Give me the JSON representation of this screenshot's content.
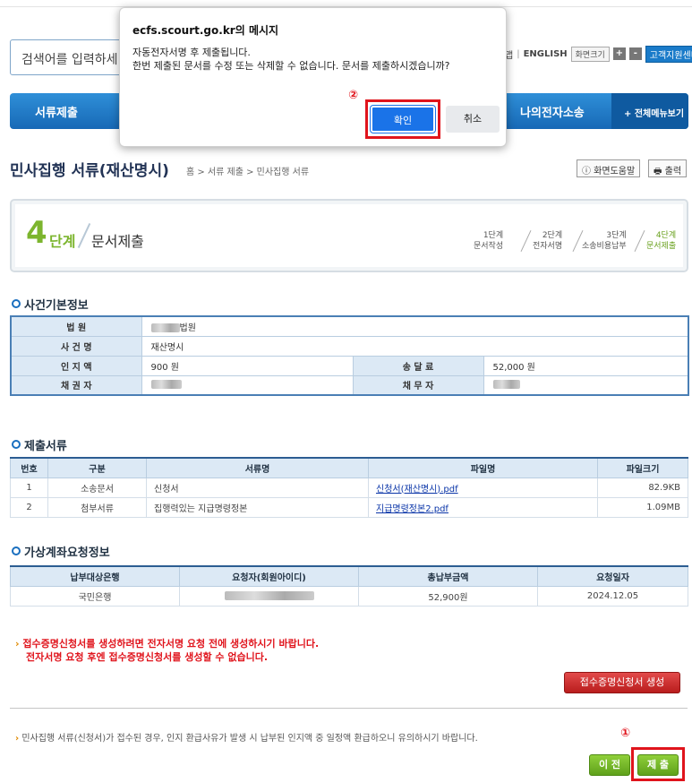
{
  "header": {
    "search_placeholder": "검색어를 입력하세",
    "links": [
      "맵",
      "ENGLISH"
    ],
    "font_btn": "화면크기",
    "zoom_in": "+",
    "zoom_out": "-",
    "cs_btn": "고객지원센터"
  },
  "nav": {
    "items": [
      "서류제출",
      "나의전자소송"
    ],
    "all_menu": "+ 전체메뉴보기"
  },
  "page": {
    "title": "민사집행 서류(재산명시)",
    "breadcrumb": "홈 > 서류 제출 > 민사집행 서류",
    "help_btn": "ⓘ 화면도움말",
    "print_btn": "출력"
  },
  "step": {
    "num": "4",
    "unit": "단계",
    "name": "문서제출",
    "steps": [
      {
        "label": "1단계",
        "sub": "문서작성"
      },
      {
        "label": "2단계",
        "sub": "전자서명"
      },
      {
        "label": "3단계",
        "sub": "소송비용납부"
      },
      {
        "label": "4단계",
        "sub": "문서제출"
      }
    ]
  },
  "case_info": {
    "title": "사건기본정보",
    "court_label": "법 원",
    "court_value": "법원",
    "case_label": "사 건 명",
    "case_value": "재산명시",
    "stamp_label": "인 지 액",
    "stamp_value": "900 원",
    "delivery_label": "송 달 료",
    "delivery_value": "52,000 원",
    "creditor_label": "채 권 자",
    "debtor_label": "채 무 자"
  },
  "files": {
    "title": "제출서류",
    "headers": [
      "번호",
      "구분",
      "서류명",
      "파일명",
      "파일크기"
    ],
    "rows": [
      {
        "no": "1",
        "type": "소송문서",
        "name": "신청서",
        "file": "신청서(재산명시).pdf",
        "size": "82.9KB"
      },
      {
        "no": "2",
        "type": "첨부서류",
        "name": "집행력있는 지급명령정본",
        "file": "지급명령정본2.pdf",
        "size": "1.09MB"
      }
    ]
  },
  "account": {
    "title": "가상계좌요청정보",
    "headers": [
      "납부대상은행",
      "요청자(회원아이디)",
      "총납부금액",
      "요청일자"
    ],
    "row": {
      "bank": "국민은행",
      "amount": "52,900원",
      "date": "2024.12.05"
    }
  },
  "warning": {
    "line1": "접수증명신청서를 생성하려면 전자서명 요청 전에 생성하시기 바랍니다.",
    "line2": "전자서명 요청 후엔 접수증명신청서를 생성할 수 없습니다."
  },
  "receipt_btn": "접수증명신청서 생성",
  "note": "민사집행 서류(신청서)가 접수된 경우, 인지 환급사유가 발생 시 납부된 인지액 중 일정액 환급하오니 유의하시기 바랍니다.",
  "prev_btn": "이 전",
  "submit_btn": "제 출",
  "badges": {
    "one": "①",
    "two": "②"
  },
  "dialog": {
    "title": "ecfs.scourt.go.kr의 메시지",
    "line1": "자동전자서명 후 제출됩니다.",
    "line2": "한번 제출된 문서를 수정 또는 삭제할 수 없습니다. 문서를 제출하시겠습니까?",
    "ok": "확인",
    "cancel": "취소"
  }
}
